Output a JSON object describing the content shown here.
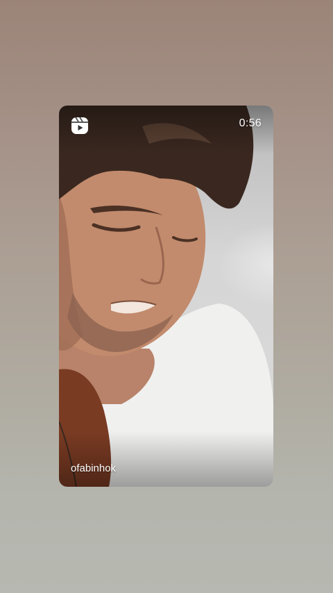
{
  "reel": {
    "icon": "reels-icon",
    "duration": "0:56",
    "username": "ofabinhok",
    "video_description_visible": false
  },
  "colors": {
    "text": "#ffffff",
    "background_top": "#9b8478",
    "background_bottom": "#b6b8b1"
  }
}
